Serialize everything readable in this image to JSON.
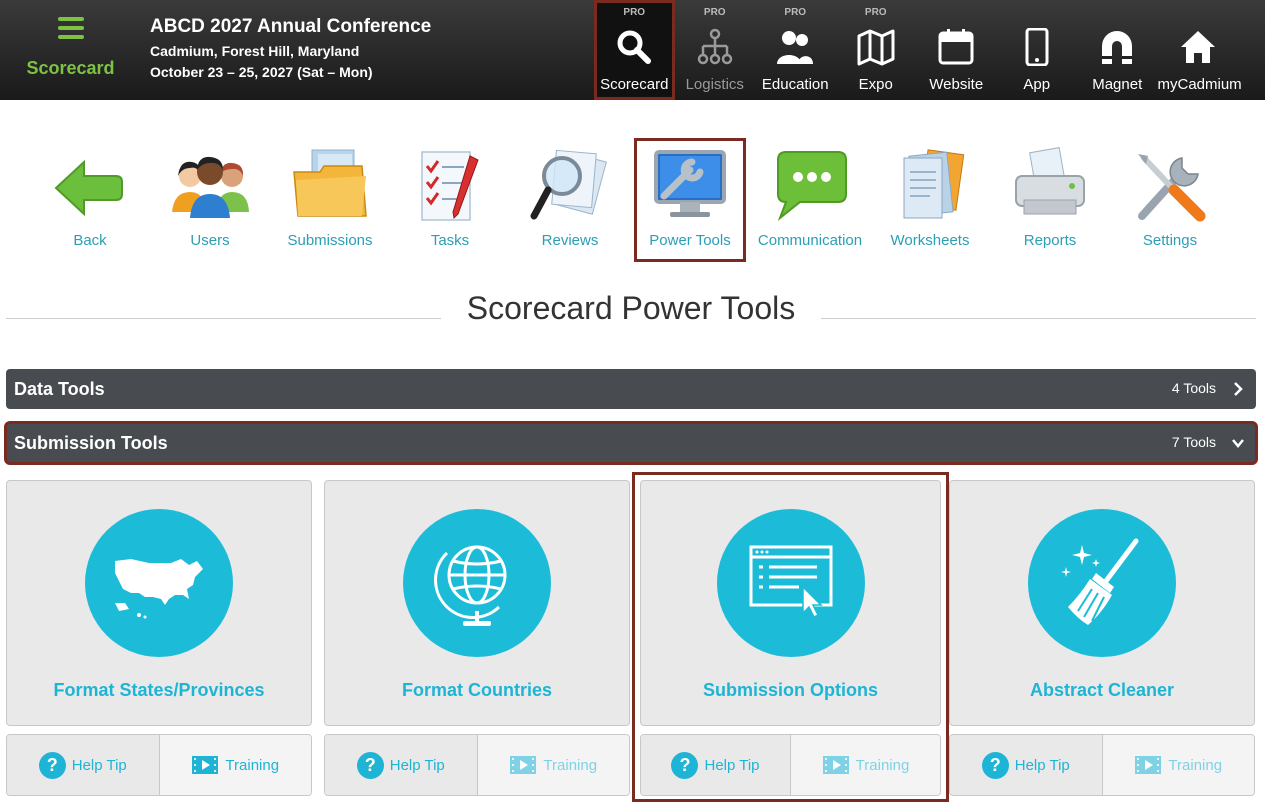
{
  "brand": {
    "label": "Scorecard"
  },
  "conference": {
    "title": "ABCD 2027 Annual Conference",
    "location": "Cadmium, Forest Hill, Maryland",
    "dates": "October 23 – 25, 2027 (Sat – Mon)"
  },
  "topnav": [
    {
      "label": "Scorecard",
      "pro": "PRO",
      "icon": "search-icon",
      "active": true
    },
    {
      "label": "Logistics",
      "pro": "PRO",
      "icon": "org-chart-icon",
      "dim": true
    },
    {
      "label": "Education",
      "pro": "PRO",
      "icon": "people-icon"
    },
    {
      "label": "Expo",
      "pro": "PRO",
      "icon": "map-icon"
    },
    {
      "label": "Website",
      "pro": "",
      "icon": "browser-icon"
    },
    {
      "label": "App",
      "pro": "",
      "icon": "phone-icon"
    },
    {
      "label": "Magnet",
      "pro": "",
      "icon": "magnet-icon"
    },
    {
      "label": "myCadmium",
      "pro": "",
      "icon": "home-icon"
    }
  ],
  "tools": [
    {
      "label": "Back",
      "icon": "back-arrow-icon"
    },
    {
      "label": "Users",
      "icon": "users-icon"
    },
    {
      "label": "Submissions",
      "icon": "folder-icon"
    },
    {
      "label": "Tasks",
      "icon": "checklist-icon"
    },
    {
      "label": "Reviews",
      "icon": "magnifier-icon"
    },
    {
      "label": "Power Tools",
      "icon": "monitor-wrench-icon",
      "active": true
    },
    {
      "label": "Communication",
      "icon": "chat-bubble-icon"
    },
    {
      "label": "Worksheets",
      "icon": "documents-icon"
    },
    {
      "label": "Reports",
      "icon": "printer-icon"
    },
    {
      "label": "Settings",
      "icon": "tools-icon"
    }
  ],
  "page": {
    "title": "Scorecard Power Tools"
  },
  "sections": [
    {
      "title": "Data Tools",
      "count": "4 Tools",
      "expanded": false
    },
    {
      "title": "Submission Tools",
      "count": "7 Tools",
      "expanded": true
    }
  ],
  "cards": [
    {
      "title": "Format States/Provinces",
      "icon": "usa-map-icon",
      "help": "Help Tip",
      "training": "Training",
      "training_active": true
    },
    {
      "title": "Format Countries",
      "icon": "globe-icon",
      "help": "Help Tip",
      "training": "Training",
      "training_active": false
    },
    {
      "title": "Submission Options",
      "icon": "form-window-icon",
      "help": "Help Tip",
      "training": "Training",
      "training_active": false
    },
    {
      "title": "Abstract Cleaner",
      "icon": "broom-icon",
      "help": "Help Tip",
      "training": "Training",
      "training_active": false
    }
  ],
  "colors": {
    "accent": "#1cbcd9",
    "brand_green": "#7dc243",
    "tool_label": "#2a9fb5",
    "highlight": "#7a2a1f",
    "bar": "#484b50"
  }
}
